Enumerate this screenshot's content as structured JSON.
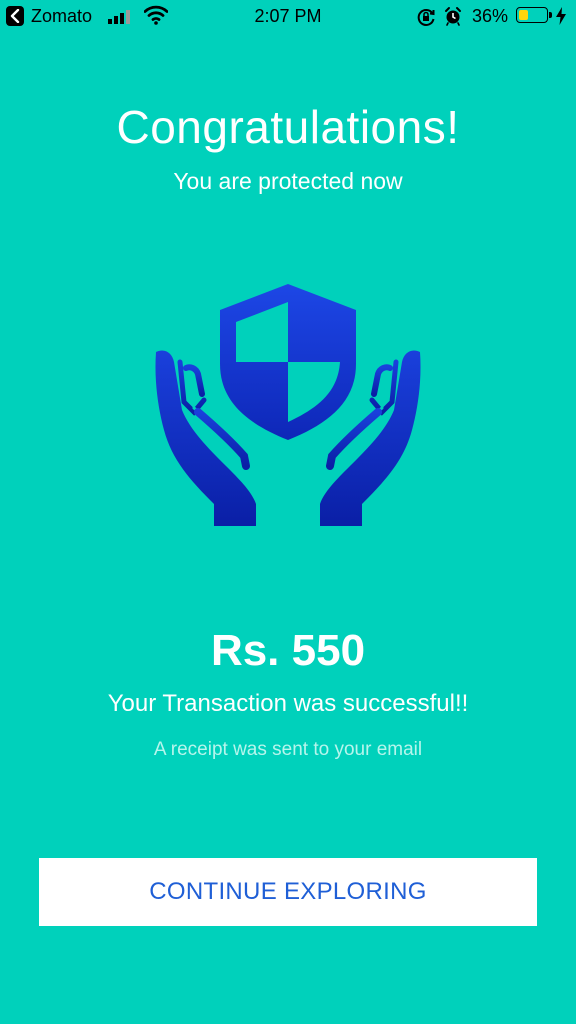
{
  "status_bar": {
    "back_app": "Zomato",
    "time": "2:07 PM",
    "battery_percent": "36%",
    "battery_level": 0.36,
    "icons": [
      "back-arrow-icon",
      "signal-icon",
      "wifi-icon",
      "orientation-lock-icon",
      "alarm-icon",
      "battery-icon",
      "charging-icon"
    ]
  },
  "main": {
    "title": "Congratulations!",
    "subtitle": "You are protected now",
    "illustration_icon": "hands-shield-icon",
    "amount": "Rs. 550",
    "success_message": "Your Transaction was successful!!",
    "receipt_message": "A receipt was sent to your email"
  },
  "actions": {
    "continue_label": "CONTINUE EXPLORING"
  },
  "colors": {
    "background": "#00d1bb",
    "button_text": "#1f5fd6",
    "icon_gradient_top": "#1d47e6",
    "icon_gradient_bottom": "#0a1fa6"
  }
}
